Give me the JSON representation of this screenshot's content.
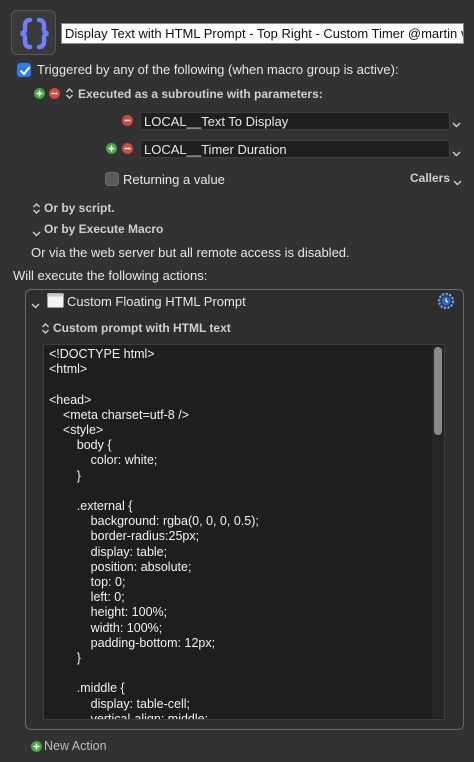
{
  "macro": {
    "title": "Display Text with HTML Prompt - Top Right - Custom Timer @martin v"
  },
  "trigger": {
    "label": "Triggered by any of the following (when macro group is active):",
    "subroutine_label": "Executed as a subroutine with parameters:",
    "params": [
      "LOCAL__Text To Display",
      "LOCAL__Timer Duration"
    ],
    "returning_label": "Returning a value",
    "callers_label": "Callers",
    "by_script": "Or by script.",
    "by_execute_macro": "Or by Execute Macro",
    "web_server": "Or via the web server but all remote access is disabled."
  },
  "actions": {
    "header": "Will execute the following actions:",
    "action_title": "Custom Floating HTML Prompt",
    "prompt_label": "Custom prompt with HTML text",
    "code": [
      "<!DOCTYPE html>",
      "<html>",
      "",
      "<head>",
      "    <meta charset=utf-8 />",
      "    <style>",
      "        body {",
      "            color: white;",
      "        }",
      "",
      "        .external {",
      "            background: rgba(0, 0, 0, 0.5);",
      "            border-radius:25px;",
      "            display: table;",
      "            position: absolute;",
      "            top: 0;",
      "            left: 0;",
      "            height: 100%;",
      "            width: 100%;",
      "            padding-bottom: 12px;",
      "        }",
      "",
      "        .middle {",
      "            display: table-cell;",
      "            vertical-align: middle;"
    ],
    "new_action": "New Action"
  },
  "colors": {
    "background": "#323232",
    "checkbox_accent": "#2d7bf4",
    "plus": "#3fa83f",
    "minus": "#d64541",
    "macro_icon_brace": "#5b6cff"
  }
}
